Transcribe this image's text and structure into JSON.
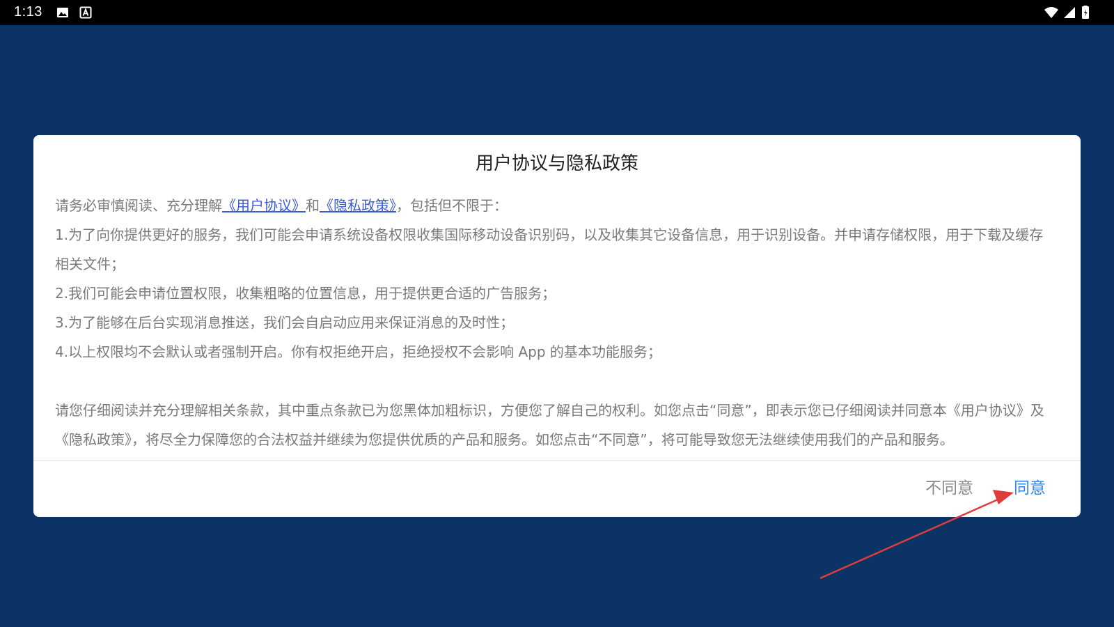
{
  "status_bar": {
    "time": "1:13",
    "left_icons": [
      "image-icon",
      "a-icon"
    ],
    "right_icons": [
      "wifi-icon",
      "signal-icon",
      "battery-icon"
    ]
  },
  "dialog": {
    "title": "用户协议与隐私政策",
    "intro_prefix": "请务必审慎阅读、充分理解",
    "user_agreement_link": "《用户协议》",
    "and_word": "和",
    "privacy_policy_link": "《隐私政策》",
    "intro_suffix": "，包括但不限于：",
    "items": [
      "1.为了向你提供更好的服务，我们可能会申请系统设备权限收集国际移动设备识别码，以及收集其它设备信息，用于识别设备。并申请存储权限，用于下载及缓存相关文件；",
      "2.我们可能会申请位置权限，收集粗略的位置信息，用于提供更合适的广告服务；",
      "3.为了能够在后台实现消息推送，我们会自启动应用来保证消息的及时性；",
      "4.以上权限均不会默认或者强制开启。你有权拒绝开启，拒绝授权不会影响 App 的基本功能服务；"
    ],
    "closing": "请您仔细阅读并充分理解相关条款，其中重点条款已为您黑体加粗标识，方便您了解自己的权利。如您点击“同意”，即表示您已仔细阅读并同意本《用户协议》及《隐私政策》，将尽全力保障您的合法权益并继续为您提供优质的产品和服务。如您点击“不同意”，将可能导致您无法继续使用我们的产品和服务。",
    "disagree_label": "不同意",
    "agree_label": "同意"
  },
  "colors": {
    "background": "#0b3366",
    "dialog_background": "#ffffff",
    "body_text": "#7a7a7a",
    "link": "#3b5bd6",
    "agree": "#2d83f0",
    "disagree": "#8a8a8a",
    "annotation_arrow": "#e03c3c"
  }
}
